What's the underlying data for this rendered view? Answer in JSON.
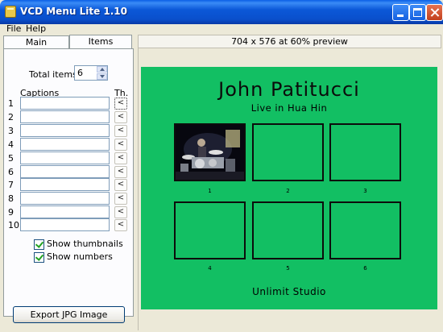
{
  "window": {
    "title": "VCD Menu Lite 1.10"
  },
  "menu": [
    "File",
    "Help"
  ],
  "tabs": [
    "Main",
    "Items"
  ],
  "items_panel": {
    "total_items_label": "Total items:",
    "total_items_value": "6",
    "captions_label": "Captions",
    "thumb_col_label": "Th.",
    "rows": [
      "1",
      "2",
      "3",
      "4",
      "5",
      "6",
      "7",
      "8",
      "9",
      "10"
    ],
    "thumb_button_glyph": "<",
    "show_thumbnails_label": "Show thumbnails",
    "show_numbers_label": "Show numbers",
    "show_thumbnails": true,
    "show_numbers": true,
    "export_label": "Export JPG Image"
  },
  "preview": {
    "header": "704 x 576 at 60% preview",
    "bg_color": "#12bf63",
    "title": "John Patitucci",
    "subtitle": "Live in Hua Hin",
    "footer": "Unlimit Studio",
    "thumb_numbers": [
      "1",
      "2",
      "3",
      "4",
      "5",
      "6"
    ]
  }
}
